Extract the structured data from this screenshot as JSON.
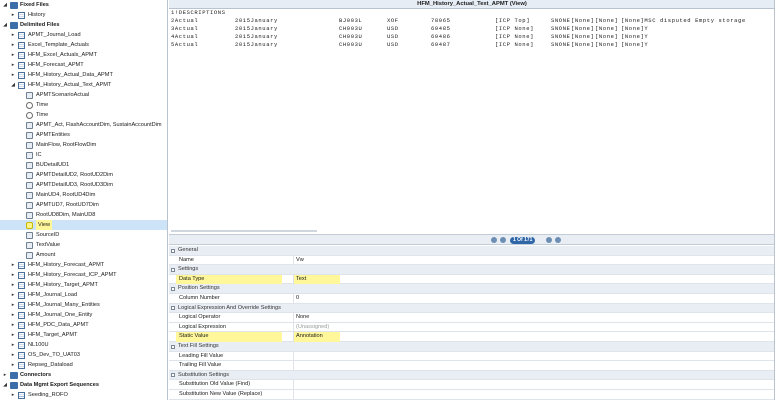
{
  "tree": [
    {
      "label": "Fixed Files",
      "level": 0,
      "kind": "folder",
      "bold": true,
      "exp": "◢"
    },
    {
      "label": "History",
      "level": 1,
      "kind": "table",
      "exp": "▸"
    },
    {
      "label": "Delimited Files",
      "level": 0,
      "kind": "folder",
      "bold": true,
      "exp": "◢"
    },
    {
      "label": "APMT_Journal_Load",
      "level": 1,
      "kind": "table",
      "exp": "▸"
    },
    {
      "label": "Excel_Template_Actuals",
      "level": 1,
      "kind": "table",
      "exp": "▸"
    },
    {
      "label": "HFM_Excel_Actuals_APMT",
      "level": 1,
      "kind": "table",
      "exp": "▸"
    },
    {
      "label": "HFM_Forecast_APMT",
      "level": 1,
      "kind": "table",
      "exp": "▸"
    },
    {
      "label": "HFM_History_Actual_Data_APMT",
      "level": 1,
      "kind": "table",
      "exp": "▸"
    },
    {
      "label": "HFM_History_Actual_Text_APMT",
      "level": 1,
      "kind": "table",
      "exp": "◢"
    },
    {
      "label": "APMTScenarioActual",
      "level": 2,
      "kind": "dim"
    },
    {
      "label": "Time",
      "level": 2,
      "kind": "clock"
    },
    {
      "label": "Time",
      "level": 2,
      "kind": "clock"
    },
    {
      "label": "APMT_Act, FlashAccountDim, SustainAccountDim",
      "level": 2,
      "kind": "dim"
    },
    {
      "label": "APMTEntities",
      "level": 2,
      "kind": "dim"
    },
    {
      "label": "MainFlow, RootFlowDim",
      "level": 2,
      "kind": "dim"
    },
    {
      "label": "IC",
      "level": 2,
      "kind": "dim"
    },
    {
      "label": "BUDetailUD1",
      "level": 2,
      "kind": "dim"
    },
    {
      "label": "APMTDetailUD2, RootUD2Dim",
      "level": 2,
      "kind": "dim"
    },
    {
      "label": "APMTDetailUD3, RootUD3Dim",
      "level": 2,
      "kind": "dim"
    },
    {
      "label": "MainUD4, RootUD4Dim",
      "level": 2,
      "kind": "dim"
    },
    {
      "label": "APMTUD7, RootUD7Dim",
      "level": 2,
      "kind": "dim"
    },
    {
      "label": "RootUD8Dim, MainUD8",
      "level": 2,
      "kind": "dim"
    },
    {
      "label": "View",
      "level": 2,
      "kind": "hl",
      "selected": true
    },
    {
      "label": "SourceID",
      "level": 2,
      "kind": "dim"
    },
    {
      "label": "TextValue",
      "level": 2,
      "kind": "dim"
    },
    {
      "label": "Amount",
      "level": 2,
      "kind": "dim"
    },
    {
      "label": "HFM_History_Forecast_APMT",
      "level": 1,
      "kind": "table",
      "exp": "▸"
    },
    {
      "label": "HFM_History_Forecast_ICP_APMT",
      "level": 1,
      "kind": "table",
      "exp": "▸"
    },
    {
      "label": "HFM_History_Target_APMT",
      "level": 1,
      "kind": "table",
      "exp": "▸"
    },
    {
      "label": "HFM_Journal_Load",
      "level": 1,
      "kind": "table",
      "exp": "▸"
    },
    {
      "label": "HFM_Journal_Many_Entities",
      "level": 1,
      "kind": "table",
      "exp": "▸"
    },
    {
      "label": "HFM_Journal_One_Entity",
      "level": 1,
      "kind": "table",
      "exp": "▸"
    },
    {
      "label": "HFM_PDC_Data_APMT",
      "level": 1,
      "kind": "table",
      "exp": "▸"
    },
    {
      "label": "HFM_Target_APMT",
      "level": 1,
      "kind": "table",
      "exp": "▸"
    },
    {
      "label": "NL100U",
      "level": 1,
      "kind": "table",
      "exp": "▸"
    },
    {
      "label": "OS_Dev_TO_UAT03",
      "level": 1,
      "kind": "table",
      "exp": "▸"
    },
    {
      "label": "Repseg_Dataload",
      "level": 1,
      "kind": "table",
      "exp": "▸"
    },
    {
      "label": "Connectors",
      "level": 0,
      "kind": "folder",
      "bold": true,
      "exp": "▸"
    },
    {
      "label": "Data Mgmt Export Sequences",
      "level": 0,
      "kind": "folder",
      "bold": true,
      "exp": "◢"
    },
    {
      "label": "Seeding_ROFO",
      "level": 1,
      "kind": "table",
      "exp": "▸"
    }
  ],
  "editor": {
    "title": "HFM_History_Actual_Text_APMT  (View)",
    "header_line": "1!DESCRIPTIONS",
    "rows": [
      [
        "2Actual",
        "2015January",
        "BJ003L",
        "XOF",
        "78065",
        "[ICP Top]",
        "SNONE",
        "[None]",
        "[None]",
        "[None]MSC disputed Empty storage"
      ],
      [
        "3Actual",
        "2015January",
        "CH003U",
        "USD",
        "60485",
        "[ICP None]",
        "SNONE",
        "[None]",
        "[None]",
        "[None]Y"
      ],
      [
        "4Actual",
        "2015January",
        "CH003U",
        "USD",
        "60486",
        "[ICP None]",
        "SNONE",
        "[None]",
        "[None]",
        "[None]Y"
      ],
      [
        "5Actual",
        "2015January",
        "CH003U",
        "USD",
        "60487",
        "[ICP None]",
        "SNONE",
        "[None]",
        "[None]",
        "[None]Y"
      ]
    ],
    "pager_label": "1 Of 171"
  },
  "props": [
    {
      "cat": true,
      "name": "General"
    },
    {
      "name": "Name",
      "value": "Vw"
    },
    {
      "cat": true,
      "name": "Settings"
    },
    {
      "name": "Data Type",
      "value": "Text",
      "hl": true
    },
    {
      "cat": true,
      "name": "Position Settings"
    },
    {
      "name": "Column Number",
      "value": "0"
    },
    {
      "cat": true,
      "name": "Logical Expression And Override Settings"
    },
    {
      "name": "Logical Operator",
      "value": "None"
    },
    {
      "name": "Logical Expression",
      "value": "(Unassigned)",
      "grey": true
    },
    {
      "name": "Static Value",
      "value": "Annotation",
      "hl": true
    },
    {
      "cat": true,
      "name": "Text Fill Settings"
    },
    {
      "name": "Leading Fill Value",
      "value": ""
    },
    {
      "name": "Trailing Fill Value",
      "value": ""
    },
    {
      "cat": true,
      "name": "Substitution Settings"
    },
    {
      "name": "Substitution Old Value (Find)",
      "value": ""
    },
    {
      "name": "Substitution New Value (Replace)",
      "value": ""
    }
  ]
}
